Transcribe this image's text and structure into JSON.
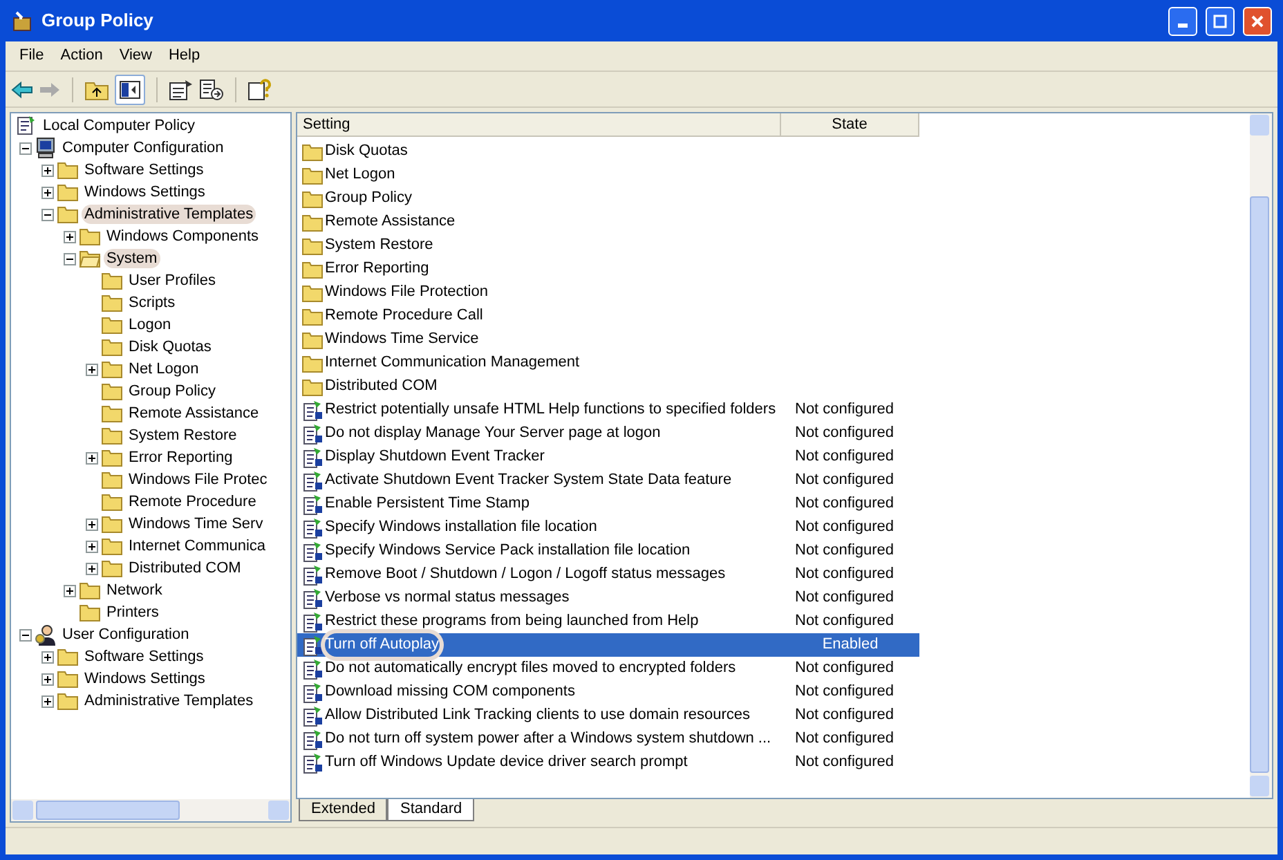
{
  "window": {
    "title": "Group Policy"
  },
  "menu": [
    "File",
    "Action",
    "View",
    "Help"
  ],
  "tree": [
    {
      "label": "Local Computer Policy",
      "kind": "policy",
      "children": [
        {
          "label": "Computer Configuration",
          "kind": "computer",
          "expanded": true,
          "children": [
            {
              "label": "Software Settings",
              "kind": "folder",
              "expanded": false
            },
            {
              "label": "Windows Settings",
              "kind": "folder",
              "expanded": false
            },
            {
              "label": "Administrative Templates",
              "kind": "folder",
              "expanded": true,
              "annotated": true,
              "children": [
                {
                  "label": "Windows Components",
                  "kind": "folder",
                  "expanded": false
                },
                {
                  "label": "System",
                  "kind": "open-folder",
                  "expanded": true,
                  "annotated": true,
                  "children": [
                    {
                      "label": "User Profiles",
                      "kind": "folder"
                    },
                    {
                      "label": "Scripts",
                      "kind": "folder"
                    },
                    {
                      "label": "Logon",
                      "kind": "folder"
                    },
                    {
                      "label": "Disk Quotas",
                      "kind": "folder"
                    },
                    {
                      "label": "Net Logon",
                      "kind": "folder",
                      "expanded": false
                    },
                    {
                      "label": "Group Policy",
                      "kind": "folder"
                    },
                    {
                      "label": "Remote Assistance",
                      "kind": "folder"
                    },
                    {
                      "label": "System Restore",
                      "kind": "folder"
                    },
                    {
                      "label": "Error Reporting",
                      "kind": "folder",
                      "expanded": false
                    },
                    {
                      "label": "Windows File Protec",
                      "kind": "folder"
                    },
                    {
                      "label": "Remote Procedure",
                      "kind": "folder"
                    },
                    {
                      "label": "Windows Time Serv",
                      "kind": "folder",
                      "expanded": false
                    },
                    {
                      "label": "Internet Communica",
                      "kind": "folder",
                      "expanded": false
                    },
                    {
                      "label": "Distributed COM",
                      "kind": "folder",
                      "expanded": false
                    }
                  ]
                },
                {
                  "label": "Network",
                  "kind": "folder",
                  "expanded": false
                },
                {
                  "label": "Printers",
                  "kind": "folder"
                }
              ]
            }
          ]
        },
        {
          "label": "User Configuration",
          "kind": "user",
          "expanded": true,
          "children": [
            {
              "label": "Software Settings",
              "kind": "folder",
              "expanded": false
            },
            {
              "label": "Windows Settings",
              "kind": "folder",
              "expanded": false
            },
            {
              "label": "Administrative Templates",
              "kind": "folder",
              "expanded": false
            }
          ]
        }
      ]
    }
  ],
  "table": {
    "columns": [
      "Setting",
      "State"
    ],
    "rows": [
      {
        "kind": "folder",
        "setting": "Disk Quotas",
        "selected": false
      },
      {
        "kind": "folder",
        "setting": "Net Logon",
        "selected": false
      },
      {
        "kind": "folder",
        "setting": "Group Policy",
        "selected": false
      },
      {
        "kind": "folder",
        "setting": "Remote Assistance",
        "selected": false
      },
      {
        "kind": "folder",
        "setting": "System Restore",
        "selected": false
      },
      {
        "kind": "folder",
        "setting": "Error Reporting",
        "selected": false
      },
      {
        "kind": "folder",
        "setting": "Windows File Protection",
        "selected": false
      },
      {
        "kind": "folder",
        "setting": "Remote Procedure Call",
        "selected": false
      },
      {
        "kind": "folder",
        "setting": "Windows Time Service",
        "selected": false
      },
      {
        "kind": "folder",
        "setting": "Internet Communication Management",
        "selected": false
      },
      {
        "kind": "folder",
        "setting": "Distributed COM",
        "selected": false
      },
      {
        "kind": "policy",
        "setting": "Restrict potentially unsafe HTML Help functions to specified folders",
        "state": "Not configured",
        "selected": false
      },
      {
        "kind": "policy",
        "setting": "Do not display Manage Your Server page at logon",
        "state": "Not configured",
        "selected": false
      },
      {
        "kind": "policy",
        "setting": "Display Shutdown Event Tracker",
        "state": "Not configured",
        "selected": false
      },
      {
        "kind": "policy",
        "setting": "Activate Shutdown Event Tracker System State Data feature",
        "state": "Not configured",
        "selected": false
      },
      {
        "kind": "policy",
        "setting": "Enable Persistent Time Stamp",
        "state": "Not configured",
        "selected": false
      },
      {
        "kind": "policy",
        "setting": "Specify Windows installation file location",
        "state": "Not configured",
        "selected": false
      },
      {
        "kind": "policy",
        "setting": "Specify Windows Service Pack installation file location",
        "state": "Not configured",
        "selected": false
      },
      {
        "kind": "policy",
        "setting": "Remove Boot / Shutdown / Logon / Logoff status messages",
        "state": "Not configured",
        "selected": false
      },
      {
        "kind": "policy",
        "setting": "Verbose vs normal status messages",
        "state": "Not configured",
        "selected": false
      },
      {
        "kind": "policy",
        "setting": "Restrict these programs from being launched from Help",
        "state": "Not configured",
        "selected": false
      },
      {
        "kind": "policy",
        "setting": "Turn off Autoplay",
        "state": "Enabled",
        "selected": true,
        "annotated": true
      },
      {
        "kind": "policy",
        "setting": "Do not automatically encrypt files moved to encrypted folders",
        "state": "Not configured",
        "selected": false
      },
      {
        "kind": "policy",
        "setting": "Download missing COM components",
        "state": "Not configured",
        "selected": false
      },
      {
        "kind": "policy",
        "setting": "Allow Distributed Link Tracking clients to use domain resources",
        "state": "Not configured",
        "selected": false
      },
      {
        "kind": "policy",
        "setting": "Do not turn off system power after a Windows system shutdown ...",
        "state": "Not configured",
        "selected": false
      },
      {
        "kind": "policy",
        "setting": "Turn off Windows Update device driver search prompt",
        "state": "Not configured",
        "selected": false
      }
    ]
  },
  "tabs": [
    {
      "label": "Extended",
      "selected": false
    },
    {
      "label": "Standard",
      "selected": true
    }
  ]
}
